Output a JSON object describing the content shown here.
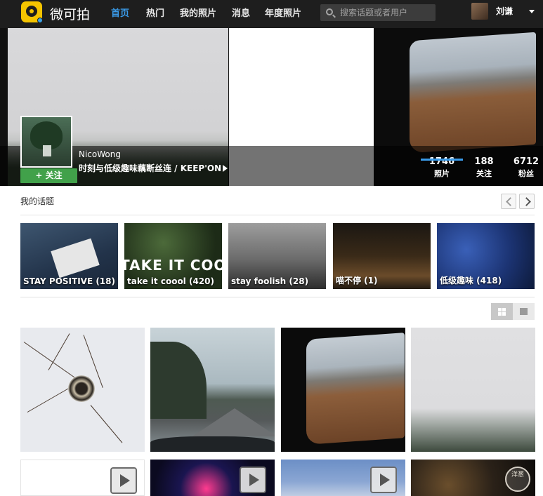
{
  "nav": {
    "app_name": "微可拍",
    "items": [
      {
        "label": "首页",
        "active": true
      },
      {
        "label": "热门",
        "active": false
      },
      {
        "label": "我的照片",
        "active": false
      },
      {
        "label": "消息",
        "active": false
      },
      {
        "label": "年度照片",
        "active": false
      }
    ],
    "search_placeholder": "搜索话题或者用户",
    "current_user": "刘谦",
    "accent_color": "#3a9be9"
  },
  "profile": {
    "username": "NicoWong",
    "bio": "时刻与低级趣味藕断丝连 / KEEP'ON",
    "follow_label": "+ 关注",
    "stats": [
      {
        "num": "1746",
        "label": "照片"
      },
      {
        "num": "188",
        "label": "关注"
      },
      {
        "num": "6712",
        "label": "粉丝"
      }
    ],
    "follow_color": "#41a14a"
  },
  "topics": {
    "title": "我的话题",
    "items": [
      {
        "label": "STAY POSITIVE (18)"
      },
      {
        "label": "take it coool (420)",
        "overlay": "TAKE IT COOO"
      },
      {
        "label": "stay foolish (28)"
      },
      {
        "label": "喵不停 (1)"
      },
      {
        "label": "低级趣味 (418)"
      }
    ]
  },
  "photos": {
    "stamp_text": "洋葱"
  }
}
